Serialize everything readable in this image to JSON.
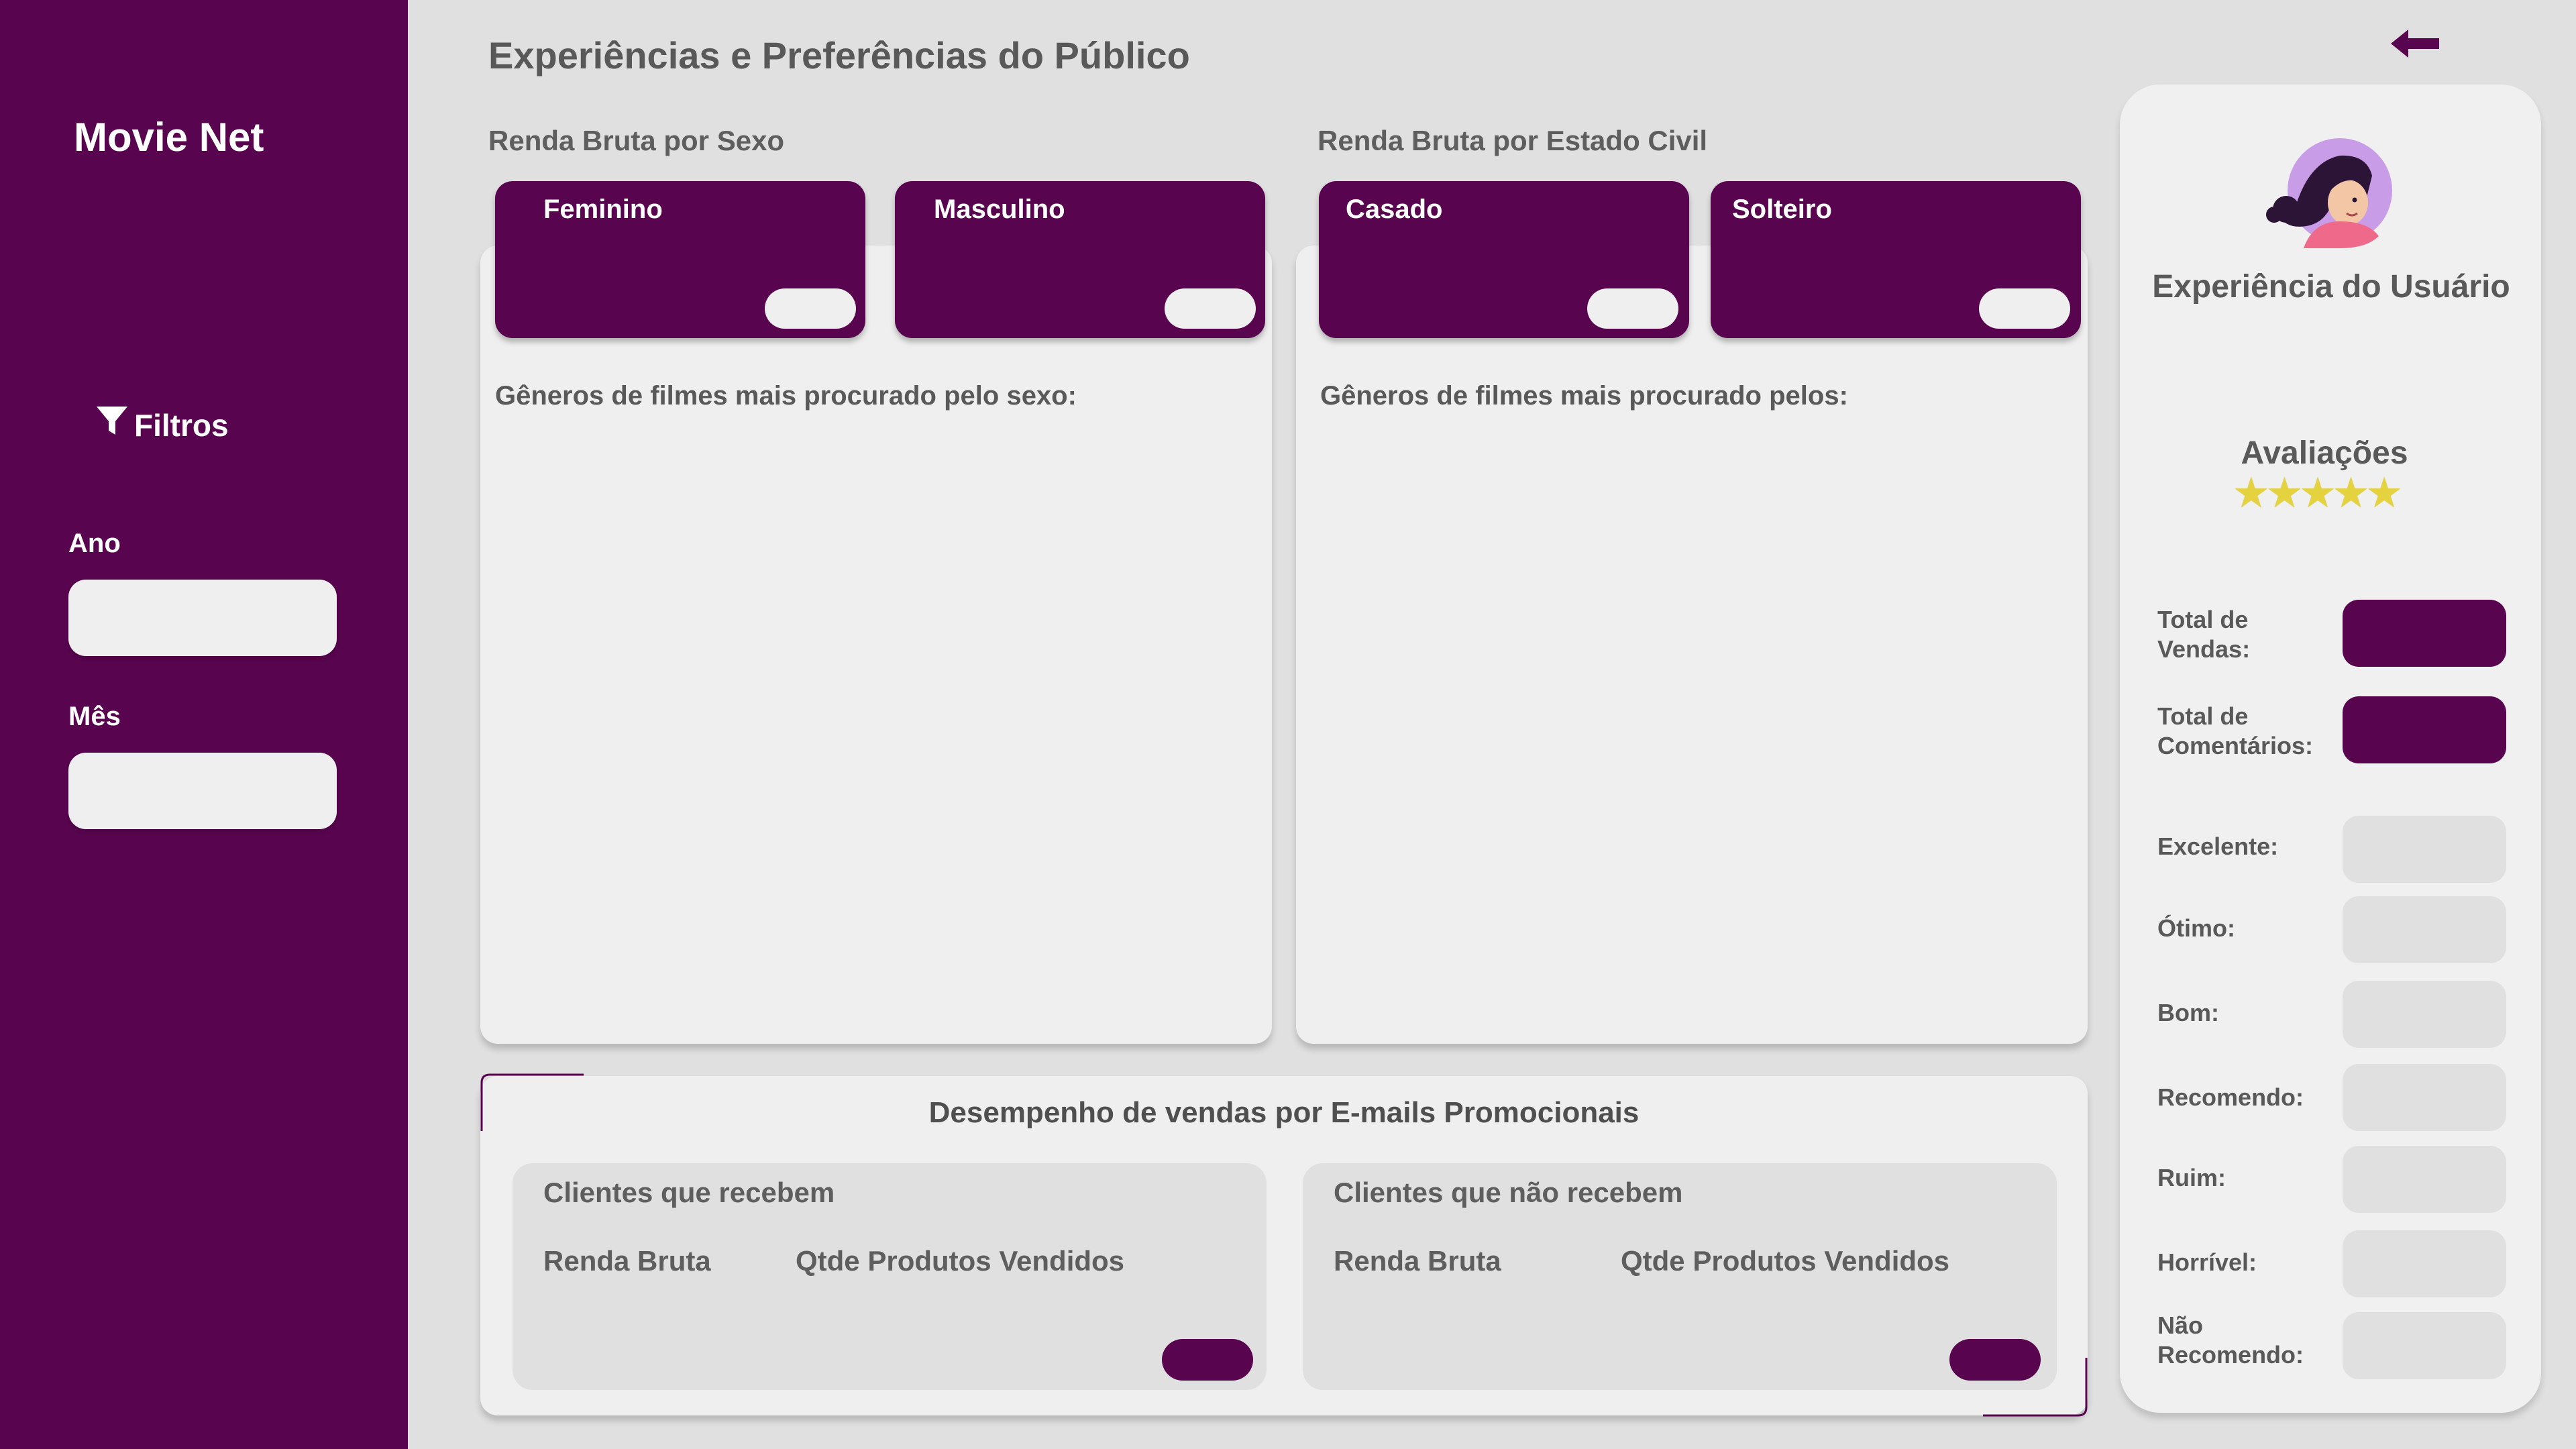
{
  "app": {
    "title": "Movie Net"
  },
  "page": {
    "title": "Experiências e Preferências do Público"
  },
  "sidebar": {
    "filters_label": "Filtros",
    "year_label": "Ano",
    "month_label": "Mês",
    "year_value": "",
    "month_value": ""
  },
  "sex_section": {
    "label": "Renda Bruta por Sexo",
    "cards": [
      {
        "label": "Feminino"
      },
      {
        "label": "Masculino"
      }
    ],
    "chart_title": "Gêneros de filmes mais procurado pelo sexo:"
  },
  "civil_section": {
    "label": "Renda Bruta por Estado Civil",
    "cards": [
      {
        "label": "Casado"
      },
      {
        "label": "Solteiro"
      }
    ],
    "chart_title": "Gêneros de filmes mais procurado pelos:"
  },
  "email_section": {
    "title": "Desempenho de vendas por E-mails Promocionais",
    "groups": [
      {
        "title": "Clientes que recebem",
        "col1": "Renda Bruta",
        "col2": "Qtde Produtos Vendidos"
      },
      {
        "title": "Clientes que não recebem",
        "col1": "Renda Bruta",
        "col2": "Qtde Produtos Vendidos"
      }
    ]
  },
  "user_panel": {
    "title": "Experiência do Usuário",
    "ratings_label": "Avaliações",
    "stars": 5,
    "stats": [
      {
        "label": "Total de Vendas:",
        "style": "dark"
      },
      {
        "label": "Total de Comentários:",
        "style": "dark"
      },
      {
        "label": "Excelente:",
        "style": "light"
      },
      {
        "label": "Ótimo:",
        "style": "light"
      },
      {
        "label": "Bom:",
        "style": "light"
      },
      {
        "label": "Recomendo:",
        "style": "light"
      },
      {
        "label": "Ruim:",
        "style": "light"
      },
      {
        "label": "Horrível:",
        "style": "light"
      },
      {
        "label": "Não Recomendo:",
        "style": "light"
      }
    ]
  },
  "icons": {
    "back": "back-arrow-icon",
    "filter": "filter-icon",
    "avatar": "user-avatar",
    "star": "star-icon"
  },
  "colors": {
    "brand": "#58044f",
    "background": "#e0e0e0",
    "panel": "#efefef",
    "star": "#e4d23e"
  }
}
